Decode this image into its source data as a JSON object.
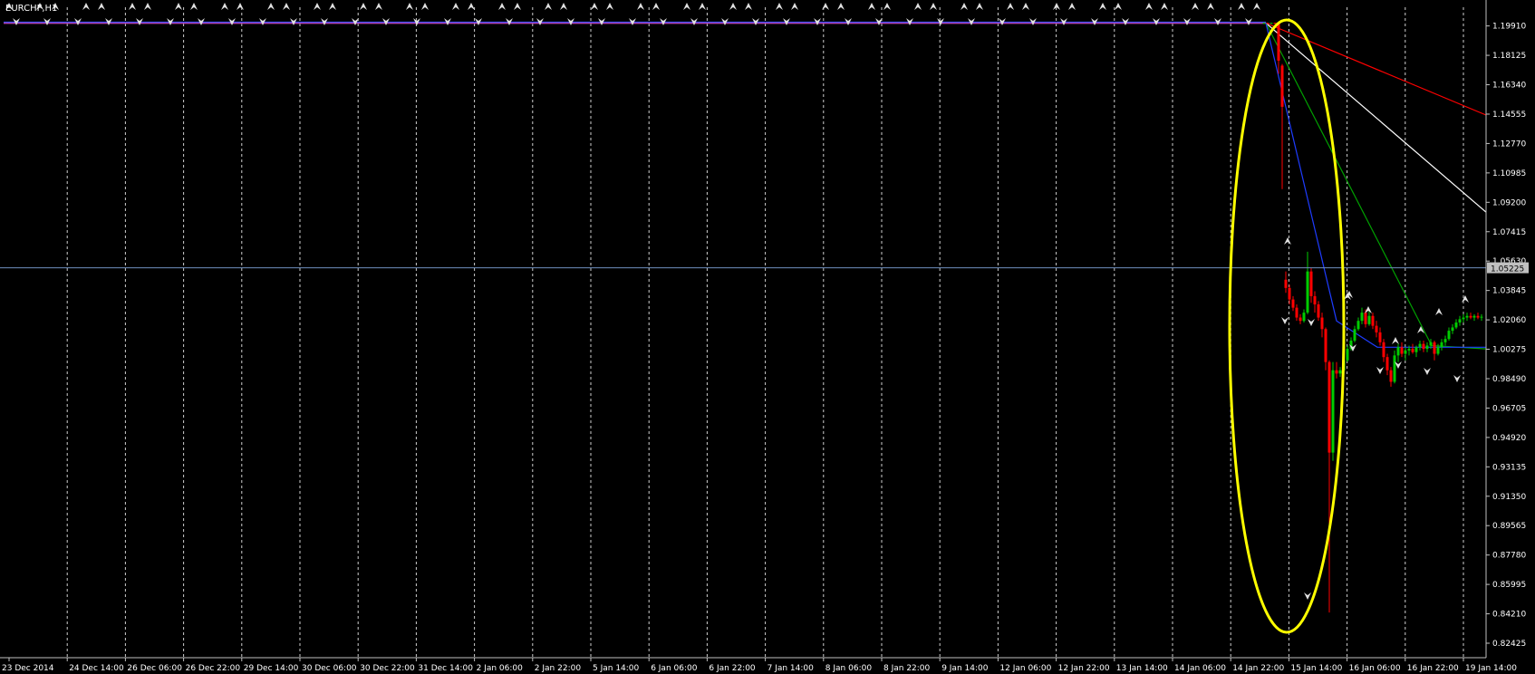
{
  "chart_data": {
    "type": "candlestick",
    "symbol_label": "EURCHF,H1",
    "bid_price": "1.05225",
    "ylim": [
      0.81545,
      1.21045
    ],
    "y_ticks": [
      "1.19910",
      "1.18125",
      "1.16340",
      "1.14555",
      "1.12770",
      "1.10985",
      "1.09200",
      "1.07415",
      "1.05630",
      "1.03845",
      "1.02060",
      "1.00275",
      "0.98490",
      "0.96705",
      "0.94920",
      "0.93135",
      "0.91350",
      "0.89565",
      "0.87780",
      "0.85995",
      "0.84210",
      "0.82425"
    ],
    "x_labels": [
      "23 Dec 2014",
      "24 Dec 14:00",
      "26 Dec 06:00",
      "26 Dec 22:00",
      "29 Dec 14:00",
      "30 Dec 06:00",
      "30 Dec 22:00",
      "31 Dec 14:00",
      "2 Jan 06:00",
      "2 Jan 22:00",
      "5 Jan 14:00",
      "6 Jan 06:00",
      "6 Jan 22:00",
      "7 Jan 14:00",
      "8 Jan 06:00",
      "8 Jan 22:00",
      "9 Jan 14:00",
      "12 Jan 06:00",
      "12 Jan 22:00",
      "13 Jan 14:00",
      "14 Jan 06:00",
      "14 Jan 22:00",
      "15 Jan 14:00",
      "16 Jan 06:00",
      "16 Jan 22:00",
      "19 Jan 14:00"
    ],
    "grid": "vertical dashed at each x label",
    "colors": {
      "background": "#000000",
      "up_candle": "#00cc00",
      "down_candle": "#ff0000",
      "ma_red": "#ff0000",
      "ma_white": "#ffffff",
      "ma_green": "#00a000",
      "ma_blue": "#1e3cff",
      "bid_line": "#6f8fbf",
      "highlight_ellipse": "#ffff00",
      "axis": "#c0c0c0"
    },
    "pre_event_level": 1.2009,
    "spike_low": 0.8429,
    "candles": [
      [
        1.2009,
        1.2012,
        1.2006,
        1.2009
      ],
      [
        1.2009,
        1.201,
        1.2005,
        1.2008
      ],
      [
        1.2008,
        1.201,
        1.2003,
        1.2009
      ],
      [
        1.2009,
        1.2011,
        1.2006,
        1.2008
      ],
      [
        1.2008,
        1.201,
        1.17,
        1.178
      ],
      [
        1.175,
        1.176,
        1.1,
        1.15
      ],
      [
        1.045,
        1.05,
        1.037,
        1.04
      ],
      [
        1.04,
        1.042,
        1.03,
        1.033
      ],
      [
        1.033,
        1.035,
        1.026,
        1.028
      ],
      [
        1.028,
        1.03,
        1.02,
        1.022
      ],
      [
        1.022,
        1.024,
        1.018,
        1.02
      ],
      [
        1.02,
        1.027,
        1.019,
        1.025
      ],
      [
        1.025,
        1.062,
        1.024,
        1.05
      ],
      [
        1.05,
        1.052,
        1.031,
        1.035
      ],
      [
        1.035,
        1.038,
        1.025,
        1.03
      ],
      [
        1.03,
        1.032,
        1.02,
        1.022
      ],
      [
        1.022,
        1.025,
        1.01,
        1.015
      ],
      [
        1.015,
        1.016,
        0.99,
        0.995
      ],
      [
        0.995,
        0.996,
        0.8429,
        0.94
      ],
      [
        0.94,
        0.995,
        0.935,
        0.99
      ],
      [
        0.99,
        0.995,
        0.985,
        0.988
      ],
      [
        0.988,
        0.992,
        0.986,
        0.99
      ],
      [
        0.99,
        0.998,
        0.989,
        0.996
      ],
      [
        0.996,
        1.005,
        0.995,
        1.003
      ],
      [
        1.003,
        1.01,
        1.002,
        1.008
      ],
      [
        1.008,
        1.017,
        1.007,
        1.015
      ],
      [
        1.015,
        1.022,
        1.014,
        1.02
      ],
      [
        1.02,
        1.028,
        1.018,
        1.025
      ],
      [
        1.025,
        1.027,
        1.016,
        1.018
      ],
      [
        1.018,
        1.026,
        1.017,
        1.023
      ],
      [
        1.023,
        1.025,
        1.015,
        1.017
      ],
      [
        1.017,
        1.02,
        1.01,
        1.013
      ],
      [
        1.013,
        1.016,
        1.005,
        1.007
      ],
      [
        1.007,
        1.009,
        0.995,
        0.998
      ],
      [
        0.998,
        1.0,
        0.987,
        0.99
      ],
      [
        0.99,
        0.992,
        0.98,
        0.983
      ],
      [
        0.983,
        1.002,
        0.982,
        0.999
      ],
      [
        0.999,
        1.006,
        0.995,
        1.004
      ],
      [
        1.004,
        1.007,
        0.998,
        1.0
      ],
      [
        1.0,
        1.004,
        0.996,
        1.002
      ],
      [
        1.002,
        1.005,
        0.999,
        1.003
      ],
      [
        1.003,
        1.006,
        1.0,
        1.001
      ],
      [
        1.001,
        1.005,
        0.998,
        1.004
      ],
      [
        1.004,
        1.008,
        1.002,
        1.006
      ],
      [
        1.006,
        1.008,
        1.001,
        1.003
      ],
      [
        1.003,
        1.007,
        1.001,
        1.005
      ],
      [
        1.005,
        1.009,
        1.003,
        1.007
      ],
      [
        1.007,
        1.008,
        0.996,
        1.0
      ],
      [
        1.0,
        1.006,
        0.999,
        1.004
      ],
      [
        1.004,
        1.009,
        1.002,
        1.007
      ],
      [
        1.007,
        1.011,
        1.005,
        1.009
      ],
      [
        1.009,
        1.016,
        1.008,
        1.014
      ],
      [
        1.014,
        1.018,
        1.012,
        1.016
      ],
      [
        1.016,
        1.021,
        1.015,
        1.019
      ],
      [
        1.019,
        1.023,
        1.017,
        1.021
      ],
      [
        1.021,
        1.024,
        1.019,
        1.022
      ],
      [
        1.022,
        1.025,
        1.02,
        1.023
      ],
      [
        1.023,
        1.025,
        1.021,
        1.022
      ],
      [
        1.022,
        1.024,
        1.02,
        1.023
      ],
      [
        1.023,
        1.025,
        1.021,
        1.022
      ],
      [
        1.022,
        1.024,
        1.02,
        1.0225
      ]
    ],
    "series": [
      {
        "color": "red",
        "points": [
          [
            1.2009,
            1.2009
          ],
          [
            1.2009,
            1.145
          ]
        ]
      },
      {
        "color": "white",
        "points": [
          [
            1.2009,
            1.2009
          ],
          [
            1.2009,
            1.086
          ]
        ]
      },
      {
        "color": "green",
        "points": [
          [
            1.2009,
            1.2009
          ],
          [
            1.2009,
            1.003
          ]
        ]
      },
      {
        "color": "blue",
        "points": [
          [
            1.2009,
            1.2009
          ],
          [
            1.02,
            1.004
          ]
        ]
      }
    ]
  }
}
